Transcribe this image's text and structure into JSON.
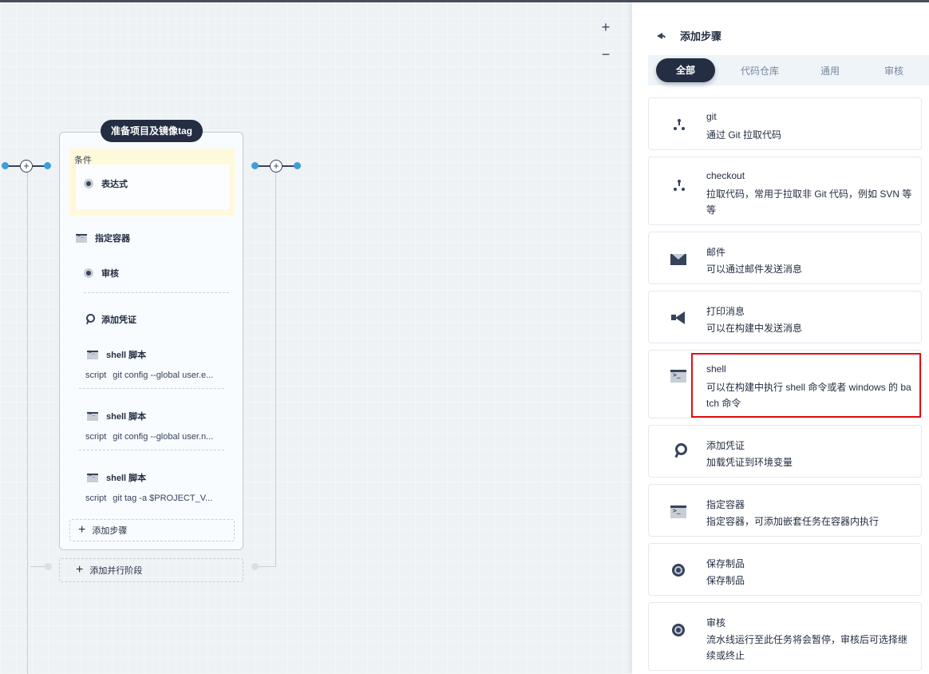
{
  "canvas": {
    "zoom_in": "+",
    "zoom_out": "−",
    "stage": {
      "title": "准备项目及镜像tag",
      "condition_label": "条件",
      "condition_item": "表达式",
      "steps": [
        {
          "icon": "terminal-icon",
          "label": "指定容器"
        },
        {
          "icon": "target-icon",
          "label": "审核"
        },
        {
          "icon": "key-icon",
          "label": "添加凭证"
        }
      ],
      "shell_steps": [
        {
          "label": "shell 脚本",
          "script_key": "script",
          "script_value": "git config --global user.e..."
        },
        {
          "label": "shell 脚本",
          "script_key": "script",
          "script_value": "git config --global user.n..."
        },
        {
          "label": "shell 脚本",
          "script_key": "script",
          "script_value": "git tag -a $PROJECT_V..."
        }
      ],
      "add_step": "添加步骤"
    },
    "add_parallel": "添加并行阶段",
    "node_plus": "+"
  },
  "panel": {
    "title": "添加步骤",
    "tabs": [
      "全部",
      "代码仓库",
      "通用",
      "审核"
    ],
    "active_tab": "全部",
    "cards": [
      {
        "icon": "git-branch-icon",
        "title": "git",
        "desc": "通过 Git 拉取代码"
      },
      {
        "icon": "git-branch-icon",
        "title": "checkout",
        "desc": "拉取代码，常用于拉取非 Git 代码，例如 SVN 等等"
      },
      {
        "icon": "mail-icon",
        "title": "邮件",
        "desc": "可以通过邮件发送消息"
      },
      {
        "icon": "megaphone-icon",
        "title": "打印消息",
        "desc": "可以在构建中发送消息"
      },
      {
        "icon": "terminal-icon",
        "title": "shell",
        "desc": "可以在构建中执行 shell 命令或者 windows 的 batch 命令"
      },
      {
        "icon": "key-icon",
        "title": "添加凭证",
        "desc": "加载凭证到环境变量"
      },
      {
        "icon": "terminal-icon",
        "title": "指定容器",
        "desc": "指定容器，可添加嵌套任务在容器内执行"
      },
      {
        "icon": "target-icon",
        "title": "保存制品",
        "desc": "保存制品"
      },
      {
        "icon": "target-icon",
        "title": "审核",
        "desc": "流水线运行至此任务将会暂停，审核后可选择继续或终止"
      }
    ],
    "highlight_color": "#e01010"
  }
}
